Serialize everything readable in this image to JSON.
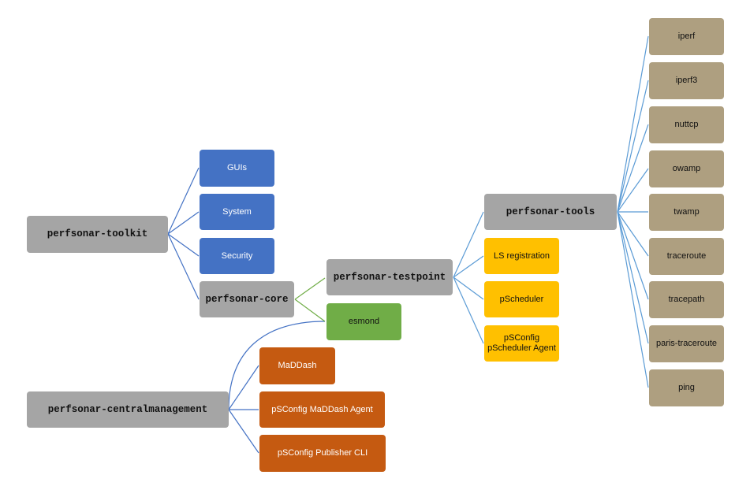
{
  "colors": {
    "gray": "#a5a5a5",
    "blue": "#4472c4",
    "green": "#70ad47",
    "yellow": "#ffc000",
    "tan": "#ae9f80",
    "orange": "#c55a11",
    "line_blue": "#4472c4",
    "line_lightblue": "#5b9bd5",
    "line_green": "#70ad47"
  },
  "toolkit": {
    "label": "perfsonar-toolkit",
    "children": [
      "GUIs",
      "System",
      "Security"
    ]
  },
  "core": {
    "label": "perfsonar-core"
  },
  "testpoint": {
    "label": "perfsonar-testpoint",
    "children": [
      "LS registration",
      "pScheduler",
      "pSConfig pScheduler Agent"
    ]
  },
  "esmond": {
    "label": "esmond"
  },
  "tools": {
    "label": "perfsonar-tools",
    "children": [
      "iperf",
      "iperf3",
      "nuttcp",
      "owamp",
      "twamp",
      "traceroute",
      "tracepath",
      "paris-traceroute",
      "ping"
    ]
  },
  "centralmanagement": {
    "label": "perfsonar-centralmanagement",
    "children": [
      "MaDDash",
      "pSConfig MaDDash Agent",
      "pSConfig Publisher CLI"
    ]
  }
}
